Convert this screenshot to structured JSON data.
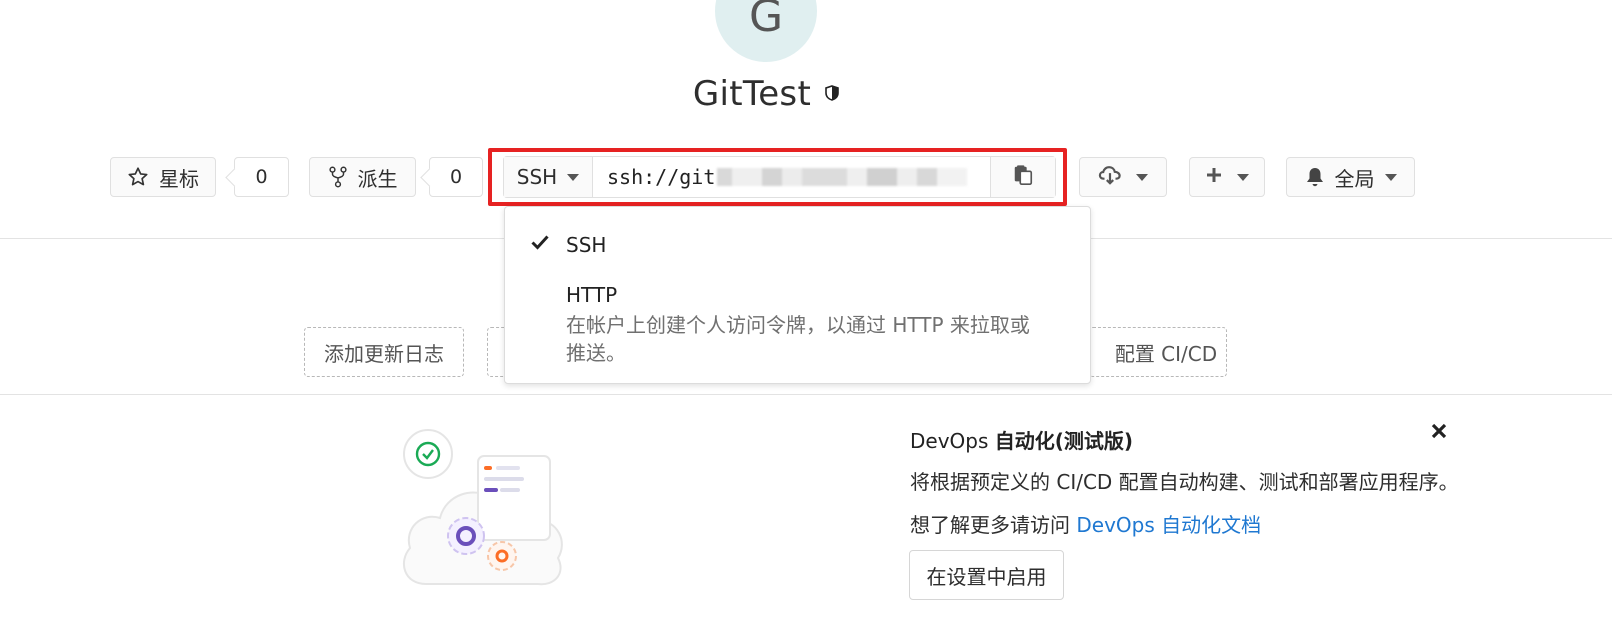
{
  "project": {
    "avatar_letter": "G",
    "name": "GitTest",
    "visibility_icon": "shield-icon"
  },
  "actions": {
    "star_label": "星标",
    "star_count": "0",
    "fork_label": "派生",
    "fork_count": "0",
    "notification_label": "全局"
  },
  "clone": {
    "protocol": "SSH",
    "url_visible": "ssh://git"
  },
  "protocol_dropdown": {
    "items": [
      {
        "label": "SSH",
        "selected": true
      },
      {
        "label": "HTTP",
        "description": "在帐户上创建个人访问令牌，以通过 HTTP 来拉取或推送。"
      }
    ]
  },
  "quick_actions": {
    "add_changelog": "添加更新日志",
    "setup_ci": "配置 CI/CD"
  },
  "devops": {
    "title_prefix": "DevOps",
    "title_bold": "自动化(测试版)",
    "description": "将根据预定义的 CI/CD 配置自动构建、测试和部署应用程序。",
    "more_prefix": "想了解更多请访问",
    "docs_link": "DevOps 自动化文档",
    "enable_button": "在设置中启用"
  },
  "colors": {
    "highlight": "#e62222",
    "link": "#1f78d1",
    "avatar_bg": "#e0eff0"
  }
}
